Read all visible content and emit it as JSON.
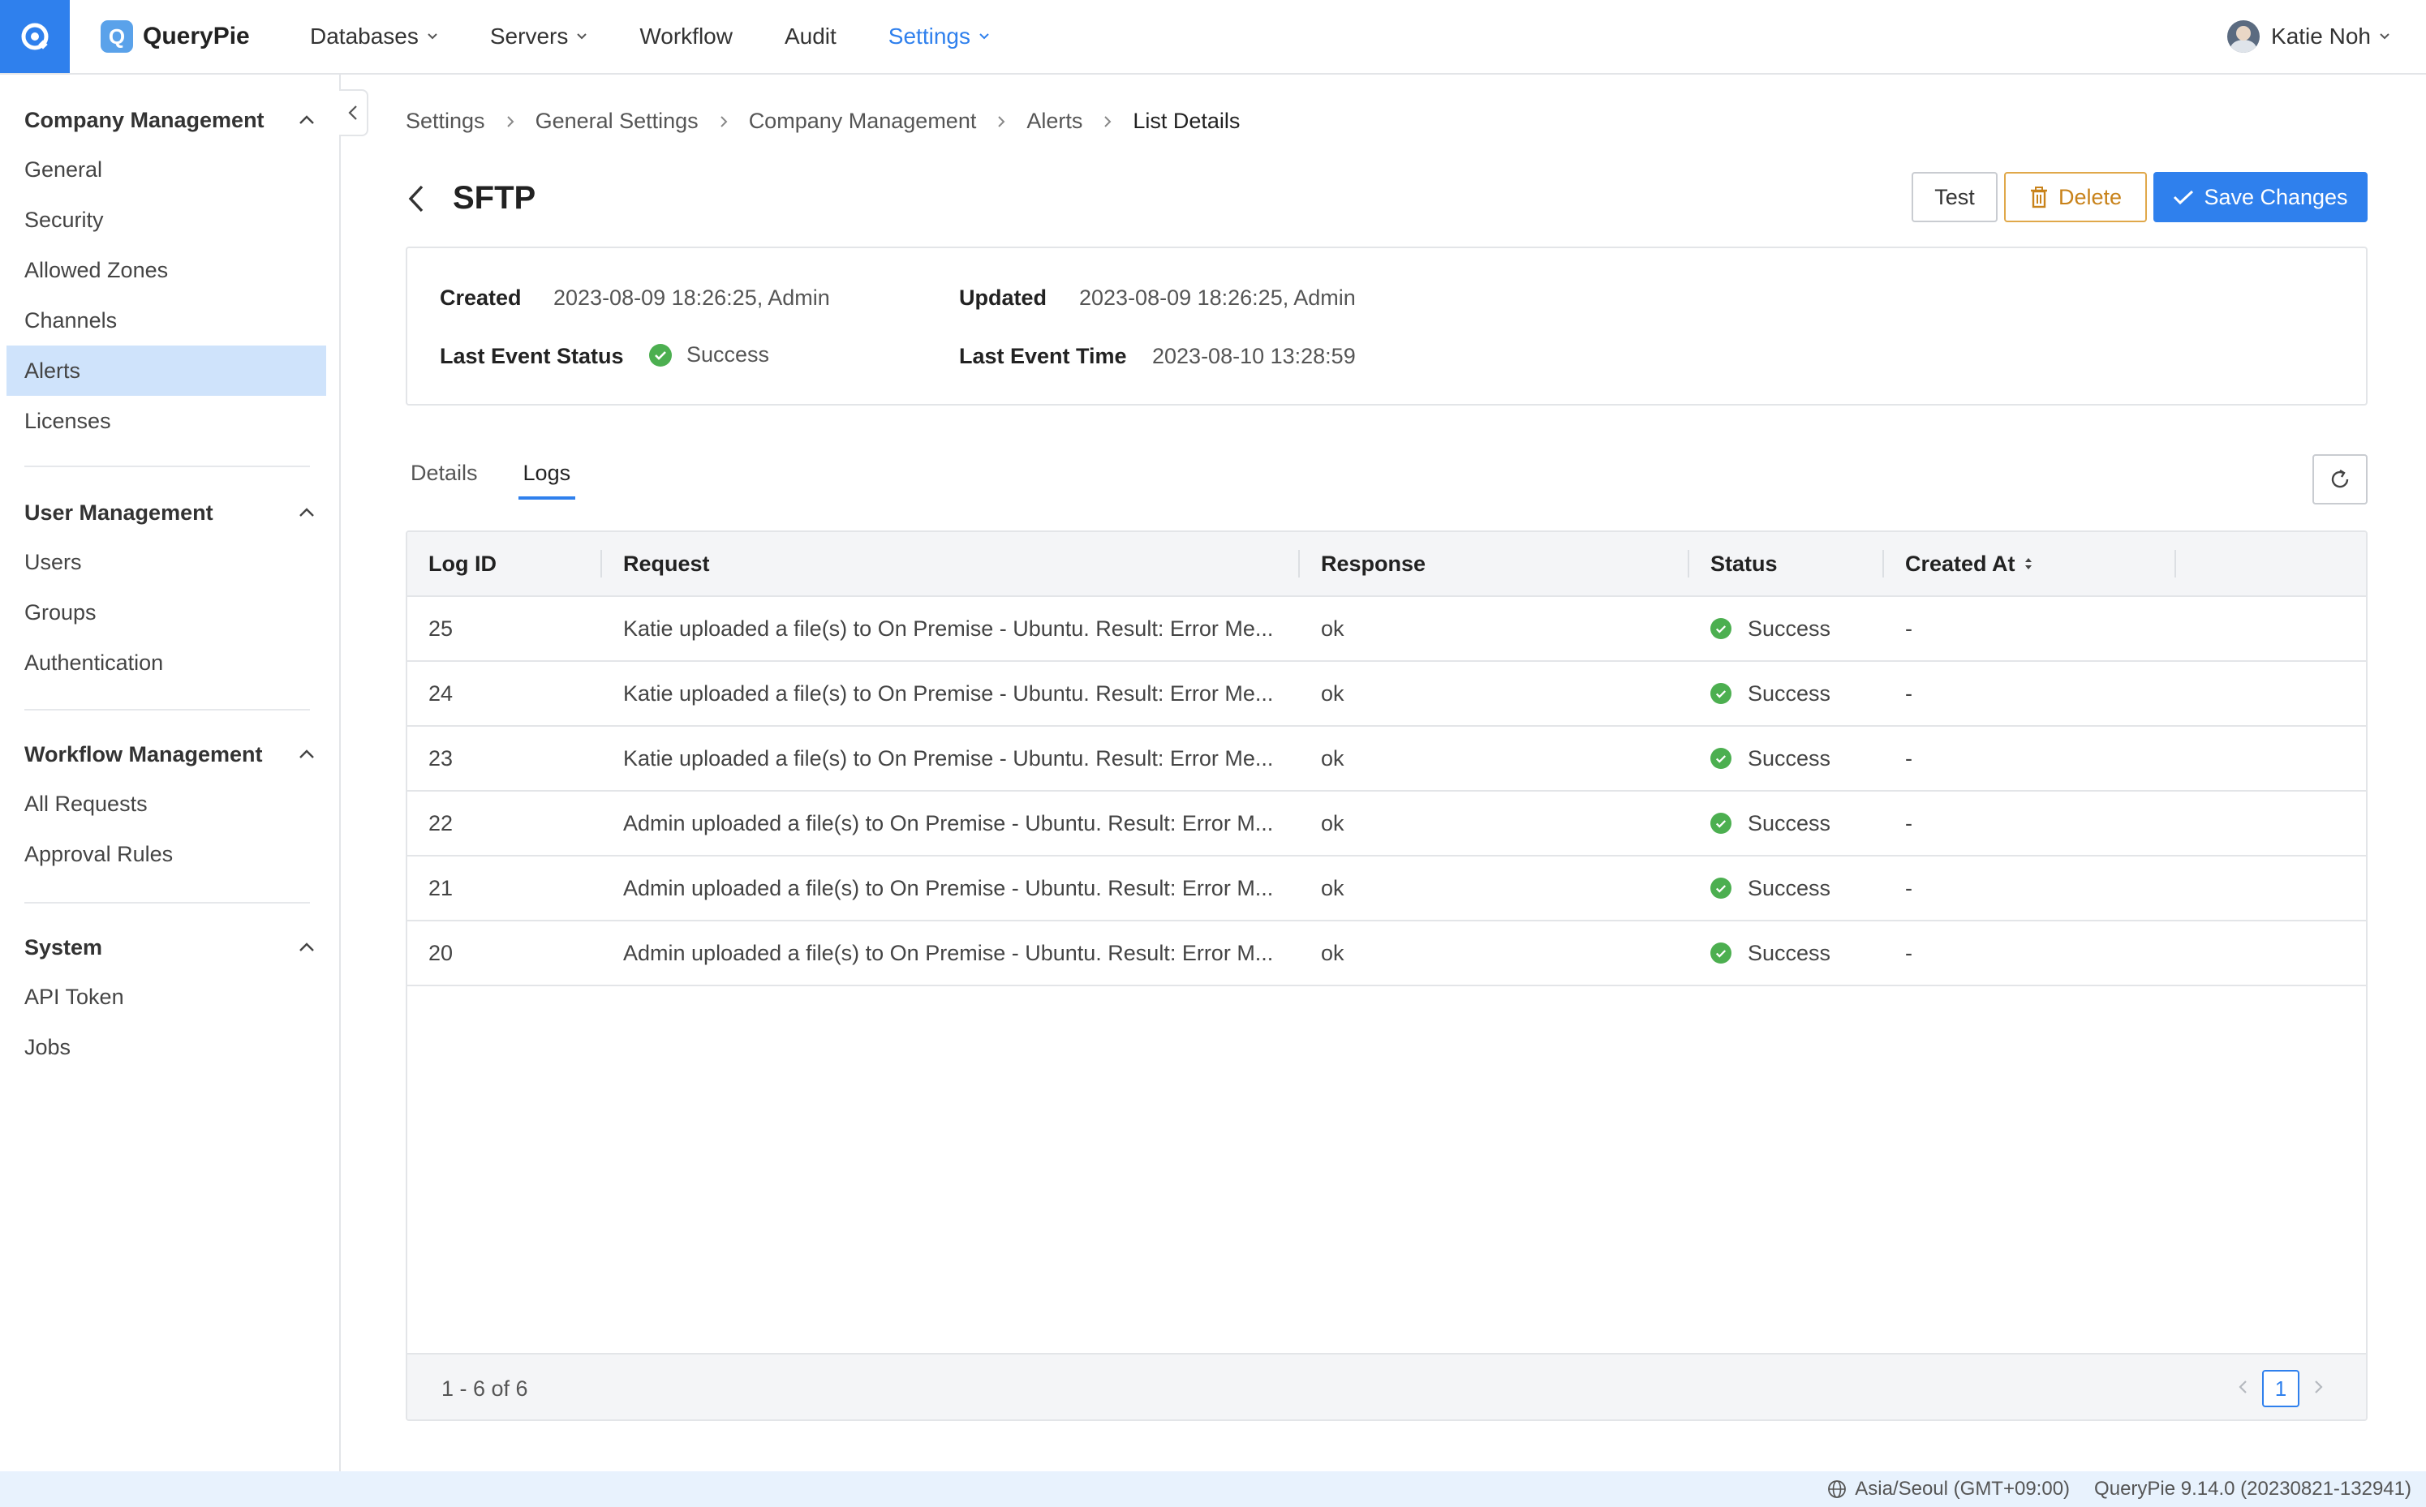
{
  "topbar": {
    "brand": "QueryPie",
    "brand_letter": "Q",
    "nav": [
      {
        "label": "Databases",
        "has_menu": true,
        "active": false
      },
      {
        "label": "Servers",
        "has_menu": true,
        "active": false
      },
      {
        "label": "Workflow",
        "has_menu": false,
        "active": false
      },
      {
        "label": "Audit",
        "has_menu": false,
        "active": false
      },
      {
        "label": "Settings",
        "has_menu": true,
        "active": true
      }
    ],
    "user_name": "Katie Noh"
  },
  "sidebar": {
    "groups": [
      {
        "title": "Company Management",
        "items": [
          "General",
          "Security",
          "Allowed Zones",
          "Channels",
          "Alerts",
          "Licenses"
        ],
        "active_item": "Alerts"
      },
      {
        "title": "User Management",
        "items": [
          "Users",
          "Groups",
          "Authentication"
        ]
      },
      {
        "title": "Workflow Management",
        "items": [
          "All Requests",
          "Approval Rules"
        ]
      },
      {
        "title": "System",
        "items": [
          "API Token",
          "Jobs"
        ]
      }
    ]
  },
  "breadcrumb": [
    "Settings",
    "General Settings",
    "Company Management",
    "Alerts",
    "List Details"
  ],
  "page": {
    "title": "SFTP",
    "buttons": {
      "test": "Test",
      "delete": "Delete",
      "save": "Save Changes"
    }
  },
  "info": {
    "created_label": "Created",
    "created_value": "2023-08-09 18:26:25, Admin",
    "updated_label": "Updated",
    "updated_value": "2023-08-09 18:26:25, Admin",
    "last_status_label": "Last Event Status",
    "last_status_value": "Success",
    "last_time_label": "Last Event Time",
    "last_time_value": "2023-08-10 13:28:59"
  },
  "tabs": [
    {
      "label": "Details",
      "active": false
    },
    {
      "label": "Logs",
      "active": true
    }
  ],
  "table": {
    "headers": [
      "Log ID",
      "Request",
      "Response",
      "Status",
      "Created At"
    ],
    "rows": [
      {
        "id": "25",
        "request": "Katie uploaded a file(s) to On Premise - Ubuntu. Result: Error Me...",
        "response": "ok",
        "status": "Success",
        "created_at": "-"
      },
      {
        "id": "24",
        "request": "Katie uploaded a file(s) to On Premise - Ubuntu. Result: Error Me...",
        "response": "ok",
        "status": "Success",
        "created_at": "-"
      },
      {
        "id": "23",
        "request": "Katie uploaded a file(s) to On Premise - Ubuntu. Result: Error Me...",
        "response": "ok",
        "status": "Success",
        "created_at": "-"
      },
      {
        "id": "22",
        "request": "Admin uploaded a file(s) to On Premise - Ubuntu. Result: Error M...",
        "response": "ok",
        "status": "Success",
        "created_at": "-"
      },
      {
        "id": "21",
        "request": "Admin uploaded a file(s) to On Premise - Ubuntu. Result: Error M...",
        "response": "ok",
        "status": "Success",
        "created_at": "-"
      },
      {
        "id": "20",
        "request": "Admin uploaded a file(s) to On Premise - Ubuntu. Result: Error M...",
        "response": "ok",
        "status": "Success",
        "created_at": "-"
      }
    ],
    "range_text": "1 - 6 of 6",
    "current_page": "1"
  },
  "statusbar": {
    "timezone": "Asia/Seoul (GMT+09:00)",
    "version": "QueryPie 9.14.0 (20230821-132941)"
  },
  "colors": {
    "accent": "#2f80ed",
    "success": "#4caf50",
    "warning": "#c8821a",
    "sidebar_active_bg": "#cfe3fb"
  },
  "icons": {
    "app": "app-switcher-icon",
    "chevron": "chevron-down-icon",
    "back": "chevron-left-icon",
    "trash": "trash-icon",
    "check": "check-icon",
    "refresh": "refresh-icon",
    "globe": "globe-icon",
    "sort": "sort-icon"
  }
}
